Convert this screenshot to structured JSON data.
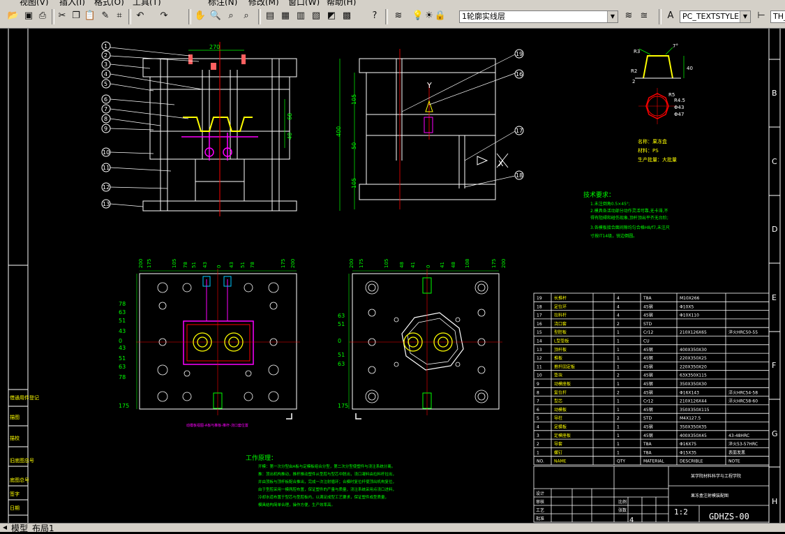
{
  "menu": [
    "视图(V)",
    "插入(I)",
    "格式(O)",
    "工具(T)",
    "标注(N)",
    "修改(M)",
    "窗口(W)",
    "帮助(H)"
  ],
  "toolbar": {
    "layer_combo": "1轮廓实线层",
    "textstyle_combo": "PC_TEXTSTYLE",
    "dimstyle_combo": "TH_"
  },
  "tabs": {
    "model": "模型",
    "layout1": "布局1"
  },
  "border_letters": [
    "B",
    "C",
    "D",
    "E",
    "F",
    "G",
    "H"
  ],
  "dims": {
    "top_w": "270",
    "top_left_h1": "68",
    "top_left_h2": "40",
    "top_right": [
      "105",
      "50",
      "105"
    ],
    "top_right_total": "400",
    "plan_left_top": [
      "200",
      "175",
      "105",
      "78",
      "51",
      "43",
      "0",
      "43",
      "51",
      "78",
      "175",
      "200"
    ],
    "plan_left_side": [
      "78",
      "63",
      "51",
      "43",
      "0",
      "43",
      "51",
      "63",
      "78",
      "175"
    ],
    "plan_right_top": [
      "200",
      "175",
      "105",
      "48",
      "41",
      "0",
      "41",
      "48",
      "108",
      "175",
      "200"
    ],
    "plan_right_side": [
      "63",
      "51",
      "0",
      "51",
      "63",
      "175"
    ]
  },
  "callouts_left": [
    "1",
    "2",
    "3",
    "4",
    "5",
    "6",
    "7",
    "8",
    "9",
    "10",
    "11",
    "12",
    "13"
  ],
  "callouts_right": [
    "19",
    "16",
    "17",
    "18"
  ],
  "part_info": {
    "name": "名称：果冻盒",
    "material": "材料：PS",
    "qty": "生产批量：大批量"
  },
  "section_labels": {
    "y": "Y",
    "x": "X"
  },
  "detail_dims": [
    "R3",
    "R2",
    "1.2",
    "2",
    "40",
    "R5",
    "7°",
    "R4.5",
    "Φ43",
    "Φ47"
  ],
  "tech_title": "技术要求：",
  "tech_lines": [
    "1.未注倒角0.5×45°;",
    "2.模具各活动部分动作灵活可靠,无卡滞,不",
    "  得有阻碍和碰伤现象,顶杆顶出平齐无台阶;",
    "3.各模板接合面间隙均匀合格H8/f7,未注尺",
    "  寸按IT14级，锐边倒圆。"
  ],
  "work_title": "工作原理：",
  "work_lines": [
    "开模：第一次分型由A板与定模板组合分型，第二次分型使塑件与浇注系统分离。",
    "推：顶出机构推动，推杆推动塑件从型腔与型芯中脱出，浇口凝料由拉料杆拉出，",
    "  并由顶板与顶杆板配合推出，完成一次注射循环；合模时复位杆使顶出机构复位，",
    "  由于型腔采用一模两腔布置，保证塑件的产量与质量，浇注系统采用点浇口进料，",
    "  冷却水道布置于型芯与型腔板内，以满足成型工艺要求，保证塑件成型质量，",
    "  模具结构简单合理，操作方便，生产效率高。"
  ],
  "plan_caption": "动模板视图-A板与推板-推杆-浇口套位置",
  "bom_rows": [
    [
      "19",
      "长推杆",
      "4",
      "T8A",
      "M10X266",
      ""
    ],
    [
      "18",
      "定位环",
      "4",
      "45钢",
      "Φ10X5",
      ""
    ],
    [
      "17",
      "拉料杆",
      "4",
      "45钢",
      "Φ10X110",
      ""
    ],
    [
      "16",
      "浇口套",
      "2",
      "STD",
      "",
      ""
    ],
    [
      "15",
      "型腔板",
      "1",
      "Cr12",
      "210X126X65",
      "淬火HRC50-55"
    ],
    [
      "14",
      "L型垫板",
      "1",
      "CU",
      "",
      ""
    ],
    [
      "13",
      "顶杆板",
      "1",
      "45钢",
      "400X350X30",
      ""
    ],
    [
      "12",
      "推板",
      "1",
      "45钢",
      "220X350X25",
      ""
    ],
    [
      "11",
      "推杆固定板",
      "1",
      "45钢",
      "220X350X20",
      ""
    ],
    [
      "10",
      "垫块",
      "2",
      "45钢",
      "63X350X115",
      ""
    ],
    [
      "9",
      "动模座板",
      "1",
      "45钢",
      "350X350X30",
      ""
    ],
    [
      "8",
      "复位杆",
      "2",
      "45钢",
      "Φ16X143",
      "淬火HRC54-58"
    ],
    [
      "7",
      "型芯",
      "1",
      "Cr12",
      "210X126X44",
      "淬火HRC58-60"
    ],
    [
      "6",
      "动模板",
      "1",
      "45钢",
      "350X350X115",
      ""
    ],
    [
      "5",
      "导柱",
      "2",
      "STD",
      "M4X127.5",
      ""
    ],
    [
      "4",
      "定模板",
      "1",
      "45钢",
      "350X350X35",
      ""
    ],
    [
      "3",
      "定模座板",
      "1",
      "45钢",
      "400X350X45",
      "43-48HRC"
    ],
    [
      "2",
      "导套",
      "1",
      "T8A",
      "Φ16X75",
      "淬火53-57HRC"
    ],
    [
      "1",
      "螺钉",
      "1",
      "T8A",
      "Φ15X35",
      "表面发黑"
    ]
  ],
  "bom_header": [
    "NO.",
    "NAME",
    "QTY",
    "MATERIAL",
    "DESCRIBLE",
    "NOTE"
  ],
  "title_block": {
    "school": "某学院材料科学与工程学院",
    "drawing_name": "果冻盒注射模装配图",
    "scale": "1:2",
    "sheet": "4",
    "code": "GDHZS-00",
    "labels": [
      "设计",
      "审核",
      "工艺",
      "批准",
      "比例",
      "张数"
    ]
  },
  "left_strip": [
    "借通用件登记",
    "旧底图总号",
    "底图总号",
    "签字",
    "日期",
    "描图",
    "描校"
  ]
}
